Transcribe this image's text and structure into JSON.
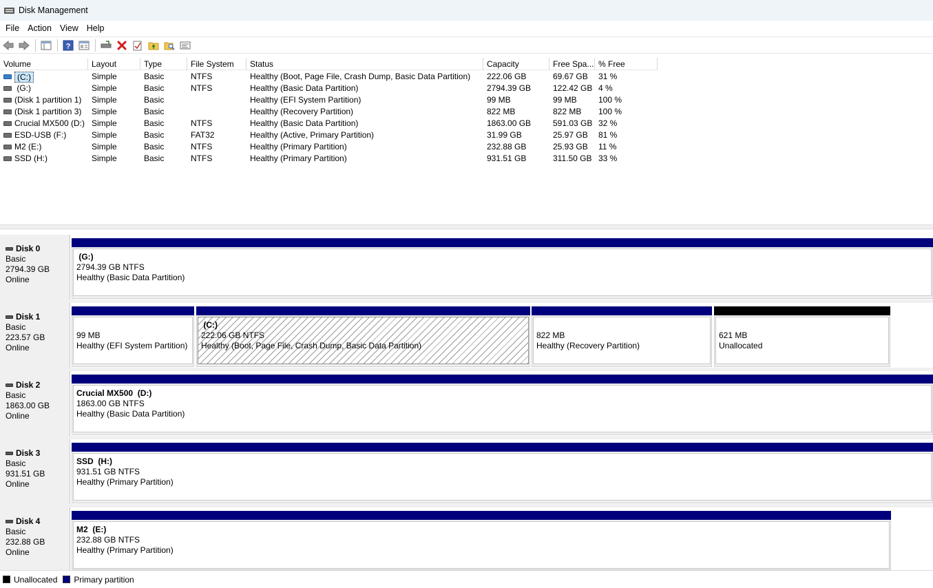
{
  "window": {
    "title": "Disk Management"
  },
  "menu": [
    "File",
    "Action",
    "View",
    "Help"
  ],
  "toolbar": {
    "buttons": [
      "back-icon",
      "forward-icon",
      "console-tree-icon",
      "help-icon",
      "properties-view-icon",
      "connect-disk-icon",
      "delete-icon",
      "check-icon",
      "folder-up-icon",
      "find-icon",
      "settings-icon"
    ]
  },
  "volume_table": {
    "columns": [
      "Volume",
      "Layout",
      "Type",
      "File System",
      "Status",
      "Capacity",
      "Free Spa...",
      "% Free"
    ],
    "rows": [
      {
        "volume": "(C:)",
        "layout": "Simple",
        "type": "Basic",
        "fs": "NTFS",
        "status": "Healthy (Boot, Page File, Crash Dump, Basic Data Partition)",
        "capacity": "222.06 GB",
        "free": "69.67 GB",
        "pct": "31 %",
        "selected": true
      },
      {
        "volume": " (G:)",
        "layout": "Simple",
        "type": "Basic",
        "fs": "NTFS",
        "status": "Healthy (Basic Data Partition)",
        "capacity": "2794.39 GB",
        "free": "122.42 GB",
        "pct": "4 %"
      },
      {
        "volume": "(Disk 1 partition 1)",
        "layout": "Simple",
        "type": "Basic",
        "fs": "",
        "status": "Healthy (EFI System Partition)",
        "capacity": "99 MB",
        "free": "99 MB",
        "pct": "100 %"
      },
      {
        "volume": "(Disk 1 partition 3)",
        "layout": "Simple",
        "type": "Basic",
        "fs": "",
        "status": "Healthy (Recovery Partition)",
        "capacity": "822 MB",
        "free": "822 MB",
        "pct": "100 %"
      },
      {
        "volume": "Crucial MX500 (D:)",
        "layout": "Simple",
        "type": "Basic",
        "fs": "NTFS",
        "status": "Healthy (Basic Data Partition)",
        "capacity": "1863.00 GB",
        "free": "591.03 GB",
        "pct": "32 %"
      },
      {
        "volume": "ESD-USB (F:)",
        "layout": "Simple",
        "type": "Basic",
        "fs": "FAT32",
        "status": "Healthy (Active, Primary Partition)",
        "capacity": "31.99 GB",
        "free": "25.97 GB",
        "pct": "81 %"
      },
      {
        "volume": "M2 (E:)",
        "layout": "Simple",
        "type": "Basic",
        "fs": "NTFS",
        "status": "Healthy (Primary Partition)",
        "capacity": "232.88 GB",
        "free": "25.93 GB",
        "pct": "11 %"
      },
      {
        "volume": "SSD (H:)",
        "layout": "Simple",
        "type": "Basic",
        "fs": "NTFS",
        "status": "Healthy (Primary Partition)",
        "capacity": "931.51 GB",
        "free": "311.50 GB",
        "pct": "33 %"
      }
    ]
  },
  "disks": [
    {
      "name": "Disk 0",
      "type": "Basic",
      "size": "2794.39 GB",
      "state": "Online",
      "partitions": [
        {
          "name": " (G:)",
          "size": "2794.39 GB NTFS",
          "status": "Healthy (Basic Data Partition)"
        }
      ]
    },
    {
      "name": "Disk 1",
      "type": "Basic",
      "size": "223.57 GB",
      "state": "Online",
      "partitions": [
        {
          "name": "",
          "size": "99 MB",
          "status": "Healthy (EFI System Partition)"
        },
        {
          "name": " (C:)",
          "size": "222.06 GB NTFS",
          "status": "Healthy (Boot, Page File, Crash Dump, Basic Data Partition)"
        },
        {
          "name": "",
          "size": "822 MB",
          "status": "Healthy (Recovery Partition)"
        },
        {
          "name": "",
          "size": "621 MB",
          "status": "Unallocated"
        }
      ]
    },
    {
      "name": "Disk 2",
      "type": "Basic",
      "size": "1863.00 GB",
      "state": "Online",
      "partitions": [
        {
          "name": "Crucial MX500  (D:)",
          "size": "1863.00 GB NTFS",
          "status": "Healthy (Basic Data Partition)"
        }
      ]
    },
    {
      "name": "Disk 3",
      "type": "Basic",
      "size": "931.51 GB",
      "state": "Online",
      "partitions": [
        {
          "name": "SSD  (H:)",
          "size": "931.51 GB NTFS",
          "status": "Healthy (Primary Partition)"
        }
      ]
    },
    {
      "name": "Disk 4",
      "type": "Basic",
      "size": "232.88 GB",
      "state": "Online",
      "partitions": [
        {
          "name": "M2  (E:)",
          "size": "232.88 GB NTFS",
          "status": "Healthy (Primary Partition)"
        }
      ]
    }
  ],
  "legend": {
    "unallocated": "Unallocated",
    "primary": "Primary partition"
  },
  "colors": {
    "primary": "#00007c",
    "unallocated": "#000000",
    "selection": "#cce8ff"
  }
}
